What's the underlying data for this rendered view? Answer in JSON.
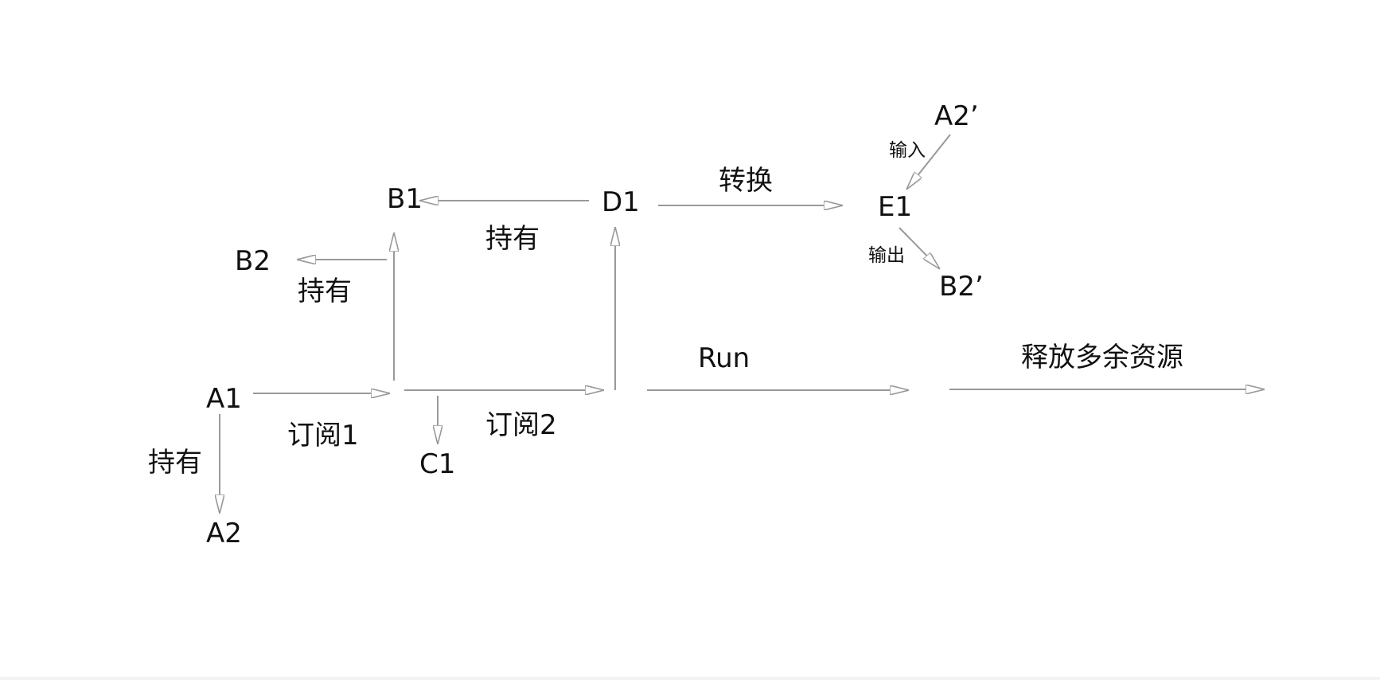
{
  "nodes": {
    "a1": "A1",
    "a2": "A2",
    "b1": "B1",
    "b2": "B2",
    "c1": "C1",
    "d1": "D1",
    "e1": "E1",
    "a2_prime": "A2’",
    "b2_prime": "B2’"
  },
  "edge_labels": {
    "a1_to_a2": "持有",
    "a1_subscribe": "订阅1",
    "b1_to_b2": "持有",
    "d1_to_b1": "持有",
    "subscribe_to_d1": "订阅2",
    "convert": "转换",
    "input": "输入",
    "output": "输出",
    "run": "Run",
    "release": "释放多余资源"
  },
  "colors": {
    "line": "#999999",
    "text": "#111111",
    "background": "#ffffff"
  }
}
